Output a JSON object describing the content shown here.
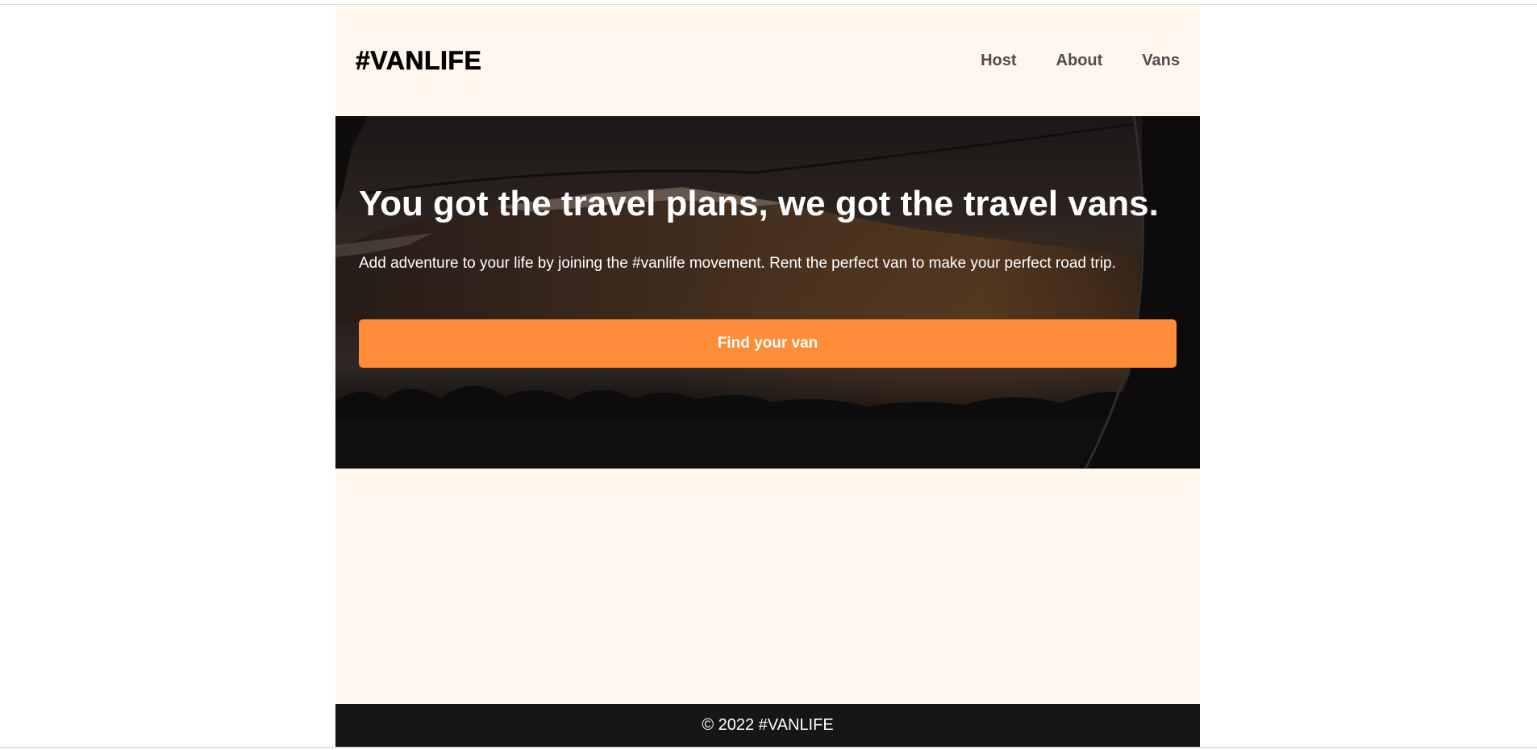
{
  "header": {
    "logo": "#VANLIFE",
    "nav": [
      {
        "label": "Host"
      },
      {
        "label": "About"
      },
      {
        "label": "Vans"
      }
    ]
  },
  "hero": {
    "title": "You got the travel plans, we got the travel vans.",
    "text": "Add adventure to your life by joining the #vanlife movement. Rent the perfect van to make your perfect road trip.",
    "cta_label": "Find your van",
    "background_image": "mountain-lake-sunset-photo"
  },
  "footer": {
    "copyright": "© 2022 #VANLIFE"
  },
  "colors": {
    "page_bg": "#fff6ed",
    "accent": "#ff8c38",
    "footer_bg": "#161616",
    "nav_text": "#4d4d4d"
  }
}
